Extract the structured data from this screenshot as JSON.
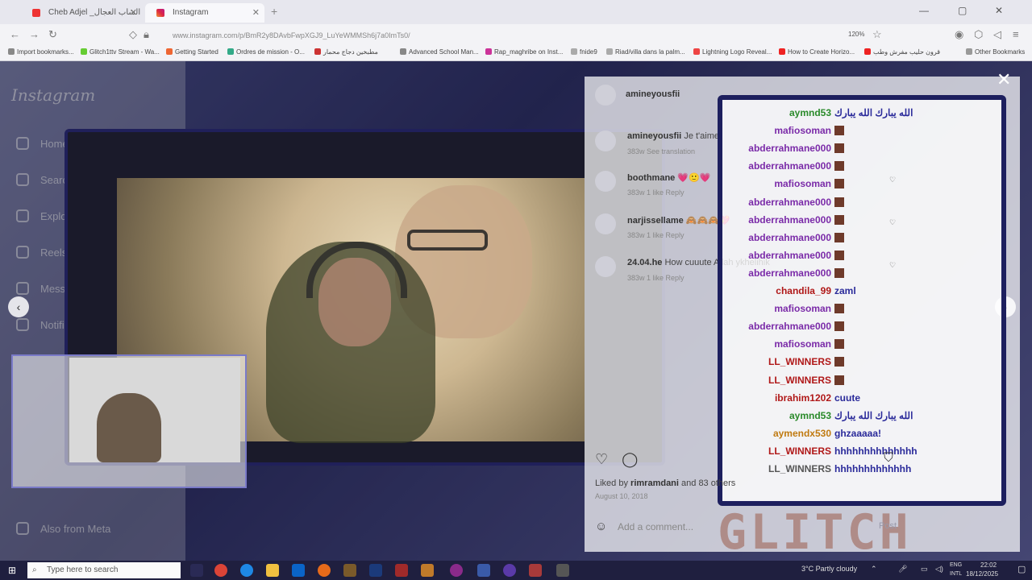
{
  "browser": {
    "tabs": [
      {
        "title": "Cheb Adjel _الشاب العجال -Halel"
      },
      {
        "title": "Instagram"
      }
    ],
    "url": "www.instagram.com/p/BmR2y8DAvbFwpXGJ9_LuYeWMMSh6j7a0ImTs0/",
    "zoom": "120%",
    "bookmarks": [
      "Import bookmarks...",
      "Glitch1ttv Stream - Wa...",
      "Getting Started",
      "Ordres de mission - O...",
      "مطبخين دجاج محمار",
      "Advanced School Man...",
      "Rap_maghribe on Inst...",
      "fnide9",
      "Riad/villa dans la palm...",
      "Lightning Logo Reveal...",
      "How to Create Horizo...",
      "قرون حليب مفرش وطب",
      "Other Bookmarks"
    ]
  },
  "instagram": {
    "logo": "Instagram",
    "nav": [
      "Home",
      "Search",
      "Explore",
      "Reels",
      "Messages",
      "Notifications"
    ],
    "more": "Also from Meta",
    "post_author": "amineyousfii",
    "comments": [
      {
        "user": "amineyousfii",
        "text": "Je t'aime",
        "meta": "383w   See translation"
      },
      {
        "user": "boothmane",
        "text": "💗🙂💗",
        "meta": "383w   1 like   Reply"
      },
      {
        "user": "narjissellame",
        "text": "🙈🙈🙈💖",
        "meta": "383w   1 like   Reply"
      },
      {
        "user": "24.04.he",
        "text": "How cuuute Allah ykhelihik",
        "meta": "383w   1 like   Reply"
      }
    ],
    "liked_by": "Liked by",
    "liked_user": "rimramdani",
    "liked_others": "and 83 others",
    "date": "August 10, 2018",
    "add_comment": "Add a comment...",
    "post_label": "Post"
  },
  "chat": {
    "lines": [
      {
        "name": "aymnd53",
        "msg": "الله يبارك الله يبارك",
        "color": "green"
      },
      {
        "name": "mafiosoman",
        "msg": "",
        "color": "purple"
      },
      {
        "name": "abderrahmane000",
        "msg": "",
        "color": "purple"
      },
      {
        "name": "abderrahmane000",
        "msg": "",
        "color": "purple"
      },
      {
        "name": "mafiosoman",
        "msg": "",
        "color": "purple"
      },
      {
        "name": "abderrahmane000",
        "msg": "",
        "color": "purple"
      },
      {
        "name": "abderrahmane000",
        "msg": "",
        "color": "purple"
      },
      {
        "name": "abderrahmane000",
        "msg": "",
        "color": "purple"
      },
      {
        "name": "abderrahmane000",
        "msg": "",
        "color": "purple"
      },
      {
        "name": "abderrahmane000",
        "msg": "",
        "color": "purple"
      },
      {
        "name": "chandila_99",
        "msg": "zaml",
        "color": "red"
      },
      {
        "name": "mafiosoman",
        "msg": "",
        "color": "purple"
      },
      {
        "name": "abderrahmane000",
        "msg": "",
        "color": "purple"
      },
      {
        "name": "mafiosoman",
        "msg": "",
        "color": "purple"
      },
      {
        "name": "LL_WINNERS",
        "msg": "",
        "color": "red"
      },
      {
        "name": "LL_WINNERS",
        "msg": "",
        "color": "red"
      },
      {
        "name": "ibrahim1202",
        "msg": "cuute",
        "color": "red"
      },
      {
        "name": "aymnd53",
        "msg": "الله يبارك الله يبارك",
        "color": "green"
      },
      {
        "name": "aymendx530",
        "msg": "ghzaaaaa!",
        "color": "orange"
      },
      {
        "name": "LL_WINNERS",
        "msg": "hhhhhhhhhhhhhh",
        "color": "red"
      },
      {
        "name": "LL_WINNERS",
        "msg": "hhhhhhhhhhhhh",
        "color": "grey"
      }
    ],
    "brand": "GLITCH"
  },
  "taskbar": {
    "search": "Type here to search",
    "weather": "3°C  Partly cloudy",
    "lang": "ENG\nINTL",
    "time": "22:02",
    "date": "18/12/2025"
  },
  "colors": {
    "chat_purple": "#7a2aa8",
    "chat_red": "#b01818",
    "chat_green": "#2a8a2a",
    "chat_orange": "#c07a10",
    "frame": "#1d1f5e"
  }
}
